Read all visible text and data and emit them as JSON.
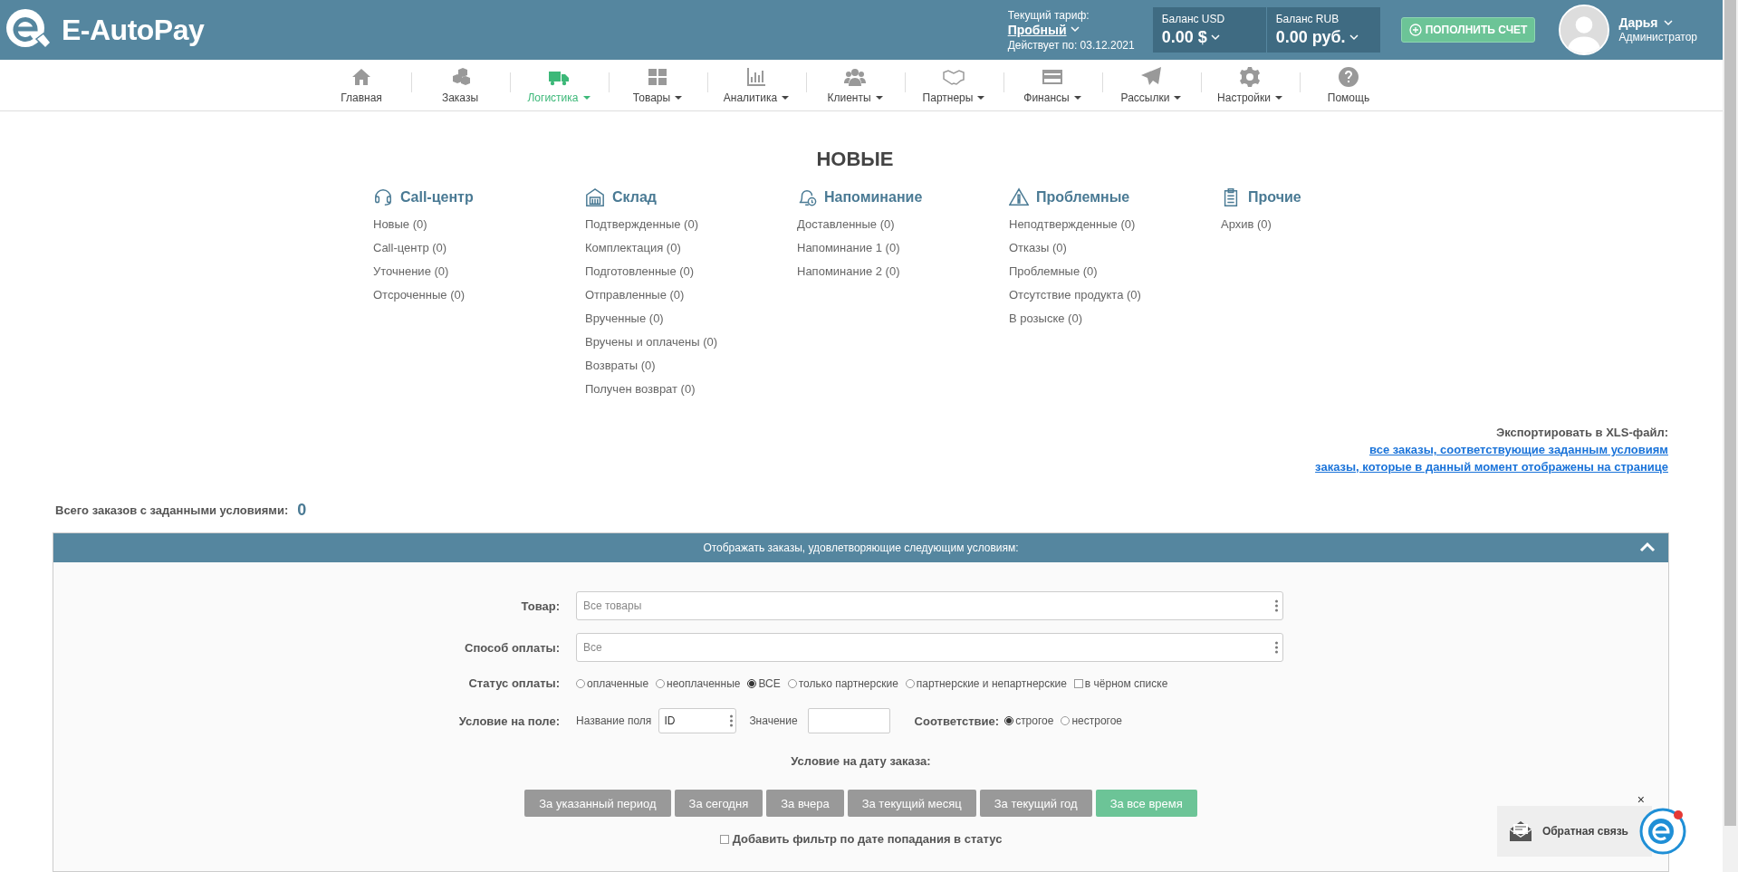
{
  "header": {
    "logo": "E-AutoPay",
    "tariff_label": "Текущий тариф:",
    "tariff": "Пробный",
    "valid_until": "Действует по: 03.12.2021",
    "balances": [
      {
        "label": "Баланс USD",
        "value": "0.00 $"
      },
      {
        "label": "Баланс RUB",
        "value": "0.00 руб."
      }
    ],
    "topup_button": "ПОПОЛНИТЬ СЧЕТ",
    "user": {
      "name": "Дарья",
      "role": "Администратор"
    }
  },
  "nav": [
    {
      "label": "Главная",
      "dropdown": false,
      "selected": false
    },
    {
      "label": "Заказы",
      "dropdown": false,
      "selected": false
    },
    {
      "label": "Логистика",
      "dropdown": true,
      "selected": true
    },
    {
      "label": "Товары",
      "dropdown": true,
      "selected": false
    },
    {
      "label": "Аналитика",
      "dropdown": true,
      "selected": false
    },
    {
      "label": "Клиенты",
      "dropdown": true,
      "selected": false
    },
    {
      "label": "Партнеры",
      "dropdown": true,
      "selected": false
    },
    {
      "label": "Финансы",
      "dropdown": true,
      "selected": false
    },
    {
      "label": "Рассылки",
      "dropdown": true,
      "selected": false
    },
    {
      "label": "Настройки",
      "dropdown": true,
      "selected": false
    },
    {
      "label": "Помощь",
      "dropdown": false,
      "selected": false
    }
  ],
  "page_title": "НОВЫЕ",
  "groups": [
    {
      "title": "Call-центр",
      "items": [
        "Новые (0)",
        "Call-центр (0)",
        "Уточнение (0)",
        "Отсроченные (0)"
      ]
    },
    {
      "title": "Склад",
      "items": [
        "Подтвержденные (0)",
        "Комплектация (0)",
        "Подготовленные (0)",
        "Отправленные (0)",
        "Врученные (0)",
        "Вручены и оплачены (0)",
        "Возвраты (0)",
        "Получен возврат (0)"
      ]
    },
    {
      "title": "Напоминание",
      "items": [
        "Доставленные (0)",
        "Напоминание 1 (0)",
        "Напоминание 2 (0)"
      ]
    },
    {
      "title": "Проблемные",
      "items": [
        "Неподтвержденные (0)",
        "Отказы (0)",
        "Проблемные (0)",
        "Отсутствие продукта (0)",
        "В розыске (0)"
      ]
    },
    {
      "title": "Прочие",
      "items": [
        "Архив (0)"
      ]
    }
  ],
  "export": {
    "label": "Экспортировать в XLS-файл:",
    "links": [
      "все заказы, соответствующие заданным условиям",
      "заказы, которые в данный момент отображены на странице"
    ]
  },
  "total": {
    "label": "Всего заказов с заданными условиями:",
    "value": "0"
  },
  "filter": {
    "title": "Отображать заказы, удовлетворяющие следующим условиям:",
    "expanded": true,
    "product": {
      "label": "Товар:",
      "placeholder": "Все товары"
    },
    "payment_method": {
      "label": "Способ оплаты:",
      "placeholder": "Все"
    },
    "payment_status": {
      "label": "Статус оплаты:",
      "options": [
        {
          "kind": "radio",
          "label": "оплаченные",
          "selected": false
        },
        {
          "kind": "radio",
          "label": "неоплаченные",
          "selected": false
        },
        {
          "kind": "radio",
          "label": "ВСЕ",
          "selected": true
        },
        {
          "kind": "radio",
          "label": "только партнерские",
          "selected": false
        },
        {
          "kind": "radio",
          "label": "партнерские и непартнерские",
          "selected": false
        },
        {
          "kind": "checkbox",
          "label": "в чёрном списке",
          "checked": false
        }
      ]
    },
    "field_condition": {
      "label": "Условие на поле:",
      "name_label": "Название поля",
      "name_value": "ID",
      "value_label": "Значение",
      "match_label": "Соответствие:",
      "match_options": [
        {
          "label": "строгое",
          "selected": true
        },
        {
          "label": "нестрогое",
          "selected": false
        }
      ]
    },
    "date_condition": {
      "label": "Условие на дату заказа:",
      "buttons": [
        {
          "label": "За указанный период",
          "selected": false
        },
        {
          "label": "За сегодня",
          "selected": false
        },
        {
          "label": "За вчера",
          "selected": false
        },
        {
          "label": "За текущий месяц",
          "selected": false
        },
        {
          "label": "За текущий год",
          "selected": false
        },
        {
          "label": "За все время",
          "selected": true
        }
      ]
    },
    "status_date_filter": {
      "label": "Добавить фильтр по дате попадания в статус",
      "checked": false
    }
  },
  "feedback": {
    "label": "Обратная связь",
    "close": "×"
  }
}
